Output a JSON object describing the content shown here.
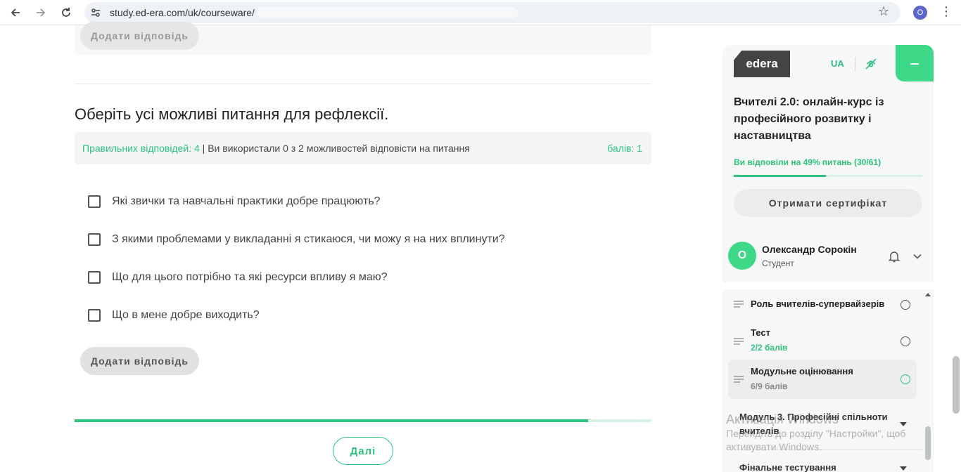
{
  "browser": {
    "url": "study.ed-era.com/uk/courseware/",
    "profile_initial": "O"
  },
  "content": {
    "prev_add_answer_label": "Додати відповідь",
    "question": "Оберіть усі можливі питання для рефлексії.",
    "correct_answers": "Правильних відповідей: 4",
    "attempts_text": "Ви використали 0 з 2 можливостей відповісти на питання",
    "points": "балів: 1",
    "options": [
      "Які звички та навчальні практики добре працюють?",
      "З якими проблемами у викладанні я стикаюся, чи можу я на них вплинути?",
      "Що для цього потрібно та які ресурси впливу я маю?",
      "Що в мене добре виходить?"
    ],
    "add_answer_label": "Додати відповідь",
    "progress_fraction": 0.89,
    "next_label": "Далі"
  },
  "sidebar": {
    "logo_text": "edera",
    "lang": "UA",
    "course_title": "Вчителі 2.0: онлайн-курс із професійного розвитку і наставництва",
    "answered": "Ви відповіли на 49% питань (30/61)",
    "answered_fraction": 0.49,
    "certificate_label": "Отримати сертифікат",
    "user": {
      "initial": "О",
      "name": "Олександр Сорокін",
      "role": "Студент"
    },
    "lessons": [
      {
        "title": "Роль вчителів-супервайзерів",
        "sub": ""
      },
      {
        "title": "Тест",
        "sub": "2/2 балів"
      },
      {
        "title": "Модульне оцінювання",
        "sub": "6/9 балів"
      }
    ],
    "modules": [
      "Модуль 3. Професійні спільноти вчителів",
      "Фінальне тестування"
    ]
  },
  "watermark": {
    "title": "Активація Windows",
    "line1": "Перейдіть до розділу \"Настройки\", щоб",
    "line2": "активувати Windows."
  },
  "colors": {
    "accent": "#2ec27e",
    "accent_bright": "#3ed889"
  }
}
